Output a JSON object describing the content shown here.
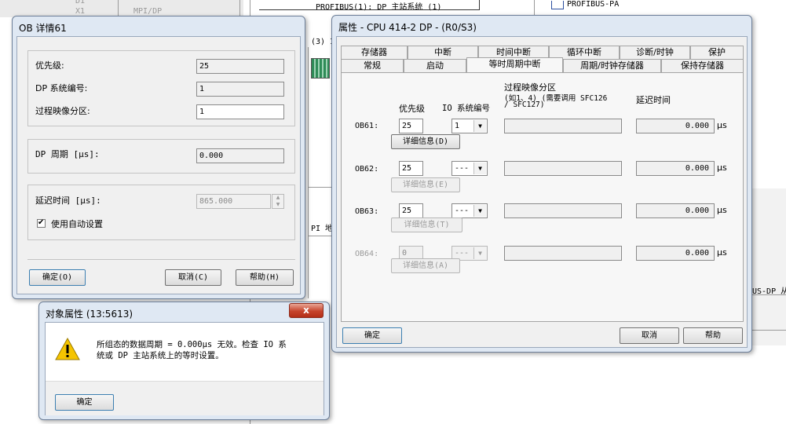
{
  "background": {
    "profibus_label": "PROFIBUS(1): DP 主站系统 (1)",
    "profibus_pa": "PROFIBUS-PA",
    "mpi_dp": "MPI/DP",
    "slot_x1": "X1",
    "slot_d1": "D1",
    "rack_label": "(3) I",
    "pi_label": "PI 地",
    "us_dp_label": "US-DP 从"
  },
  "ob_dialog": {
    "title": "OB 详情61",
    "priority_label": "优先级:",
    "priority_value": "25",
    "dp_system_label": "DP 系统编号:",
    "dp_system_value": "1",
    "process_image_label": "过程映像分区:",
    "process_image_value": "1",
    "dp_cycle_label": "DP 周期 [μs]:",
    "dp_cycle_value": "0.000",
    "delay_label": "延迟时间 [μs]:",
    "delay_value": "865.000",
    "auto_setting_label": "使用自动设置",
    "auto_setting_checked": true,
    "ok_label": "确定(O)",
    "cancel_label": "取消(C)",
    "help_label": "帮助(H)"
  },
  "msg_dialog": {
    "title": "对象属性 (13:5613)",
    "message_line1": "所组态的数据周期 = 0.000μs 无效。检查 IO 系",
    "message_line2": "统或 DP 主站系统上的等时设置。",
    "ok_label": "确定",
    "close_glyph": "x"
  },
  "props_dialog": {
    "title": "属性 - CPU 414-2 DP - (R0/S3)",
    "tabs_row1": [
      "存储器",
      "中断",
      "时间中断",
      "循环中断",
      "诊断/时钟",
      "保护"
    ],
    "tabs_row2": [
      "常规",
      "启动",
      "等时周期中断",
      "周期/时钟存储器",
      "保持存储器"
    ],
    "active_tab": "等时周期中断",
    "col_priority": "优先级",
    "col_io_system": "IO 系统编号",
    "col_process_image_1": "过程映像分区",
    "col_process_image_2": "(如1、4) (需要调用 SFC126",
    "col_process_image_3": "/ SFC127)",
    "col_delay": "延迟时间",
    "unit": "μs",
    "rows": [
      {
        "ob": "OB61:",
        "priority": "25",
        "io": "1",
        "delay": "0.000",
        "details": "详细信息(D)",
        "enabled": true
      },
      {
        "ob": "OB62:",
        "priority": "25",
        "io": "---",
        "delay": "0.000",
        "details": "详细信息(E)",
        "enabled": true
      },
      {
        "ob": "OB63:",
        "priority": "25",
        "io": "---",
        "delay": "0.000",
        "details": "详细信息(T)",
        "enabled": true
      },
      {
        "ob": "OB64:",
        "priority": "0",
        "io": "---",
        "delay": "0.000",
        "details": "详细信息(A)",
        "enabled": false
      }
    ],
    "ok_label": "确定",
    "cancel_label": "取消",
    "help_label": "帮助"
  }
}
